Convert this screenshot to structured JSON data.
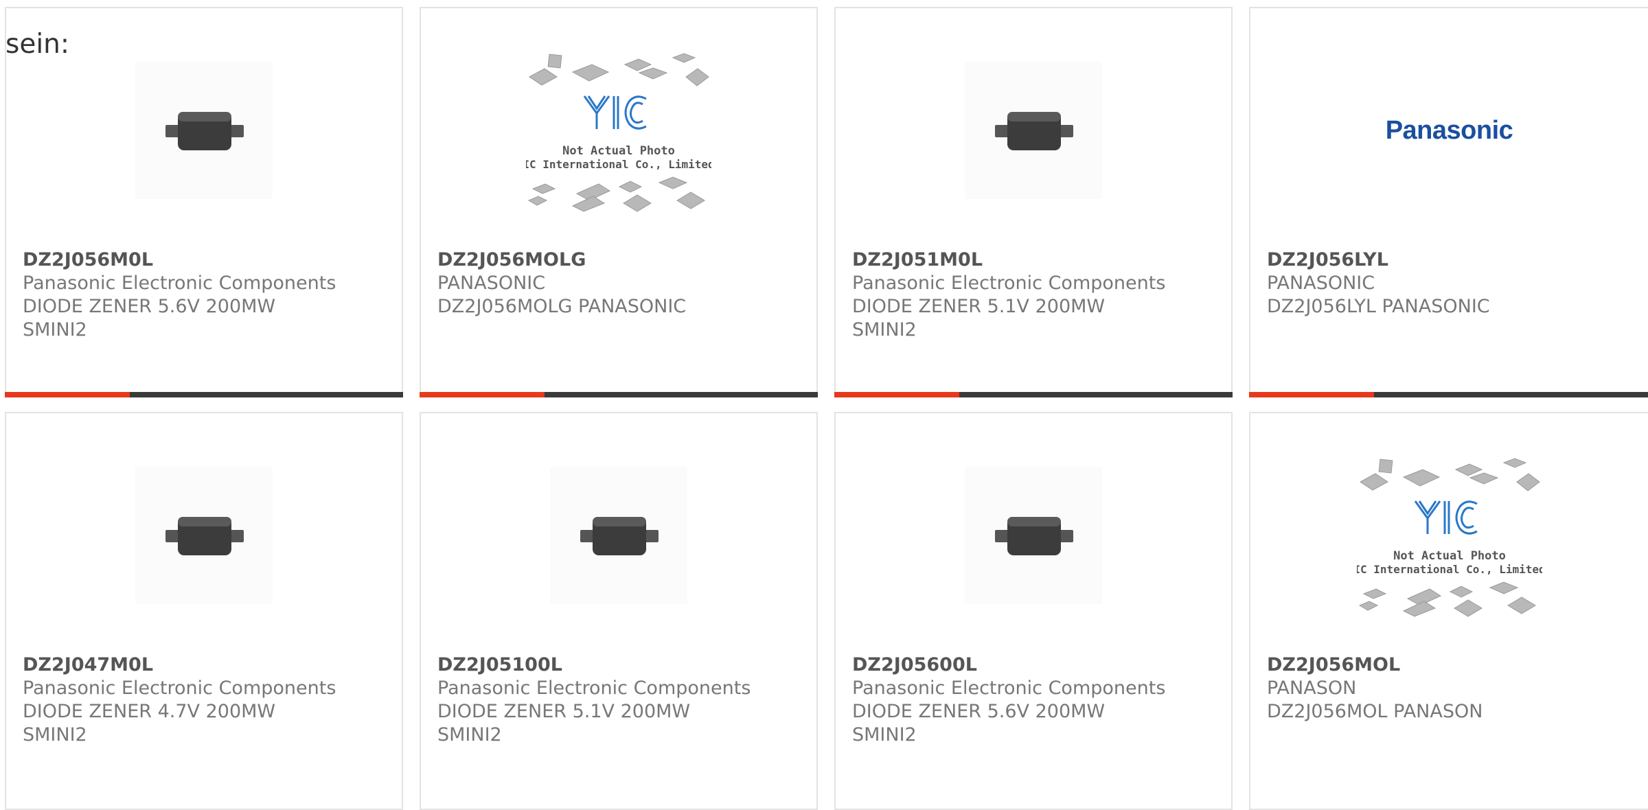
{
  "page": {
    "heading": "sein:"
  },
  "colors": {
    "accent": "#e8391c",
    "bar": "#3a3a3a",
    "border": "#e3e3e3",
    "text": "#777777",
    "part_number": "#555555",
    "brand_blue": "#1a4fa0"
  },
  "products": [
    {
      "part_number": "DZ2J056M0L",
      "manufacturer": "Panasonic Electronic Components",
      "description": "DIODE ZENER 5.6V 200MW",
      "package": "SMINI2",
      "image": "diode-photo"
    },
    {
      "part_number": "DZ2J056MOLG",
      "manufacturer": "PANASONIC",
      "description": "DZ2J056MOLG PANASONIC",
      "package": "",
      "image": "yic-placeholder",
      "placeholder_line1": "Not Actual Photo",
      "placeholder_line2": "YIC International Co., Limited."
    },
    {
      "part_number": "DZ2J051M0L",
      "manufacturer": "Panasonic Electronic Components",
      "description": "DIODE ZENER 5.1V 200MW",
      "package": "SMINI2",
      "image": "diode-photo"
    },
    {
      "part_number": "DZ2J056LYL",
      "manufacturer": "PANASONIC",
      "description": "DZ2J056LYL PANASONIC",
      "package": "",
      "image": "panasonic-logo",
      "logo_text": "Panasonic"
    },
    {
      "part_number": "DZ2J047M0L",
      "manufacturer": "Panasonic Electronic Components",
      "description": "DIODE ZENER 4.7V 200MW",
      "package": "SMINI2",
      "image": "diode-photo"
    },
    {
      "part_number": "DZ2J05100L",
      "manufacturer": "Panasonic Electronic Components",
      "description": "DIODE ZENER 5.1V 200MW",
      "package": "SMINI2",
      "image": "diode-photo"
    },
    {
      "part_number": "DZ2J05600L",
      "manufacturer": "Panasonic Electronic Components",
      "description": "DIODE ZENER 5.6V 200MW",
      "package": "SMINI2",
      "image": "diode-photo"
    },
    {
      "part_number": "DZ2J056MOL",
      "manufacturer": "PANASON",
      "description": "DZ2J056MOL PANASON",
      "package": "",
      "image": "yic-placeholder",
      "placeholder_line1": "Not Actual Photo",
      "placeholder_line2": "YIC International Co., Limited."
    }
  ]
}
